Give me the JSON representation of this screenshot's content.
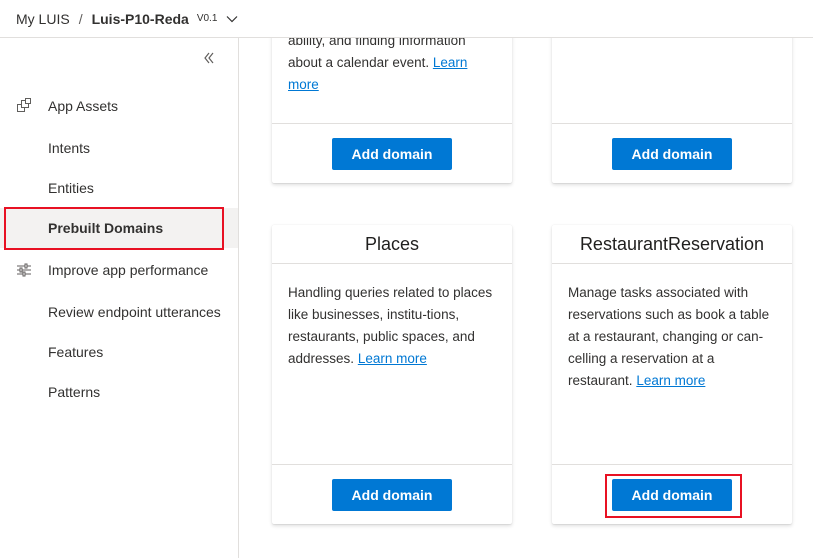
{
  "header": {
    "breadcrumb_root": "My LUIS",
    "separator": "/",
    "app_name": "Luis-P10-Reda",
    "version": "V0.1"
  },
  "sidebar": {
    "items": [
      {
        "label": "App Assets"
      },
      {
        "label": "Intents"
      },
      {
        "label": "Entities"
      },
      {
        "label": "Prebuilt Domains"
      },
      {
        "label": "Improve app performance"
      },
      {
        "label": "Review endpoint utterances"
      },
      {
        "label": "Features"
      },
      {
        "label": "Patterns"
      }
    ]
  },
  "cards": [
    {
      "title": "",
      "desc_line1": "ability, and finding information",
      "desc_line2": "about a calendar event.",
      "learn_more": "Learn",
      "learn_more_2": "more",
      "button": "Add domain"
    },
    {
      "title": "",
      "button": "Add domain"
    },
    {
      "title": "Places",
      "desc": "Handling queries related to places like businesses, institu-tions, restaurants, public spaces, and addresses.",
      "learn_more": "Learn more",
      "button": "Add domain"
    },
    {
      "title": "RestaurantReservation",
      "desc": "Manage tasks associated with reservations such as book a table at a restaurant, changing or can-celling a reservation at a restaurant.",
      "learn_more": "Learn more",
      "button": "Add domain"
    }
  ],
  "colors": {
    "accent": "#0078d4",
    "highlight": "#e81123"
  }
}
